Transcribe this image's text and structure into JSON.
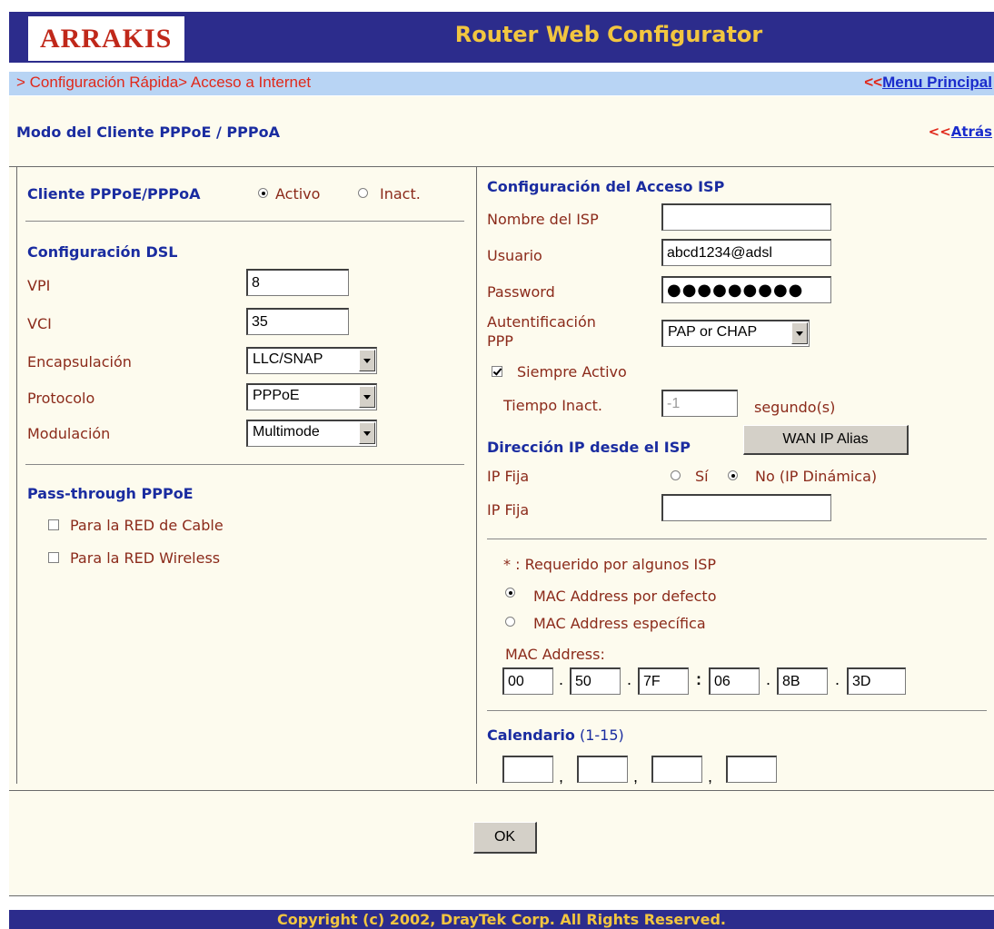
{
  "header": {
    "logo_text": "ARRAKIS",
    "title": "Router Web Configurator"
  },
  "breadcrumb": {
    "path": "> Configuración Rápida> Acceso a Internet",
    "menu_prefix": "<<",
    "menu_link": "Menu Principal"
  },
  "page": {
    "title": "Modo del Cliente PPPoE / PPPoA",
    "back_prefix": "<<",
    "back_link": "Atrás"
  },
  "client": {
    "label": "Cliente PPPoE/PPPoA",
    "active_label": "Activo",
    "inactive_label": "Inact.",
    "selected": "Activo"
  },
  "dsl": {
    "title": "Configuración DSL",
    "vpi_label": "VPI",
    "vpi_value": "8",
    "vci_label": "VCI",
    "vci_value": "35",
    "encap_label": "Encapsulación",
    "encap_value": "LLC/SNAP",
    "protocol_label": "Protocolo",
    "protocol_value": "PPPoE",
    "modulation_label": "Modulación",
    "modulation_value": "Multimode"
  },
  "passthrough": {
    "title": "Pass-through PPPoE",
    "cable_label": "Para la RED de Cable",
    "cable_checked": false,
    "wireless_label": "Para la RED Wireless",
    "wireless_checked": false
  },
  "isp": {
    "title": "Configuración del Acceso ISP",
    "name_label": "Nombre del ISP",
    "name_value": "",
    "user_label": "Usuario",
    "user_value": "abcd1234@adsl",
    "password_label": "Password",
    "password_value": "●●●●●●●●●",
    "auth_label_1": "Autentificación",
    "auth_label_2": "PPP",
    "auth_value": "PAP or CHAP",
    "always_on_label": "Siempre Activo",
    "always_on_checked": true,
    "idle_label": "Tiempo Inact.",
    "idle_value": "-1",
    "idle_unit": "segundo(s)"
  },
  "wan_ip": {
    "title": "Dirección IP desde el ISP",
    "alias_button": "WAN IP Alias",
    "fixed_label": "IP Fija",
    "yes_label": "Sí",
    "no_label": "No (IP Dinámica)",
    "selected": "No",
    "fixed_ip_label": "IP Fija",
    "fixed_ip_value": ""
  },
  "mac": {
    "note": "* : Requerido por algunos ISP",
    "default_label": "MAC Address por defecto",
    "specific_label": "MAC Address específica",
    "selected": "default",
    "address_label": "MAC Address:",
    "octets": [
      "00",
      "50",
      "7F",
      "06",
      "8B",
      "3D"
    ],
    "separators": [
      ".",
      ".",
      ":",
      ".",
      "."
    ]
  },
  "schedule": {
    "title": "Calendario",
    "range": "(1-15)",
    "values": [
      "",
      "",
      "",
      ""
    ],
    "separators": [
      ",",
      ",",
      ","
    ]
  },
  "ok_button": "OK",
  "footer": {
    "text": "Copyright (c) 2002, DrayTek Corp. All Rights Reserved."
  }
}
